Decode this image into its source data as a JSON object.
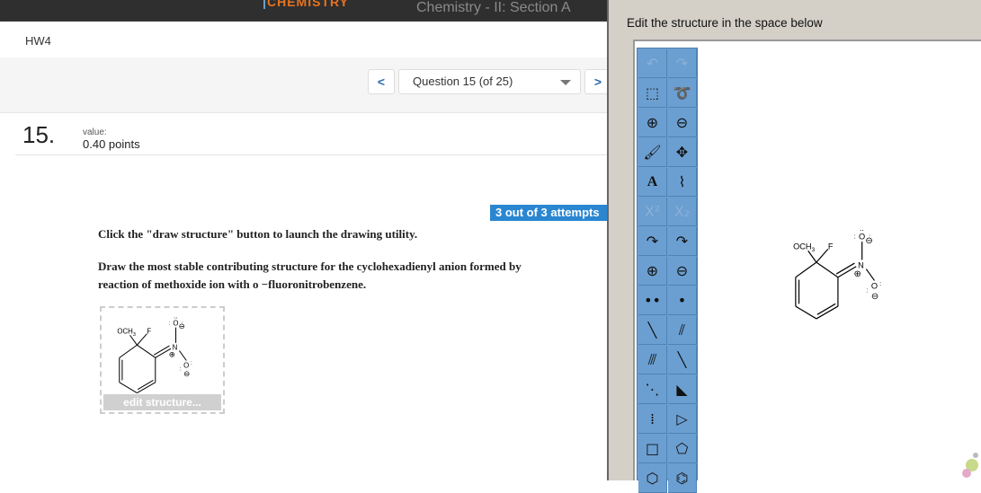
{
  "header": {
    "brand": "CHEMISTRY",
    "course": "Chemistry - II: Section A",
    "assignment": "HW4"
  },
  "nav": {
    "prev": "<",
    "next": ">",
    "question_select": "Question 15 (of 25)"
  },
  "question": {
    "number": "15.",
    "value_label": "value:",
    "points": "0.40 points",
    "attempts": "3 out of 3 attempts",
    "instruction1": "Click the \"draw structure\" button to launch the drawing utility.",
    "instruction2": "Draw the most stable contributing structure for the cyclohexadienyl anion formed by",
    "instruction3": "reaction of methoxide ion with o −fluoronitrobenzene.",
    "edit_button": "edit structure..."
  },
  "molecule": {
    "och3": "OCH",
    "sub3": "3",
    "f": "F",
    "n": "N",
    "o": "O",
    "plus": "⊕",
    "minus": "⊖"
  },
  "editor": {
    "title": "Edit the structure in the space below",
    "tools": [
      {
        "icon": "undo-icon",
        "g": "↶",
        "d": true
      },
      {
        "icon": "redo-icon",
        "g": "↷",
        "d": true
      },
      {
        "icon": "rect-select-icon",
        "g": "⬚"
      },
      {
        "icon": "lasso-icon",
        "g": "➰"
      },
      {
        "icon": "zoom-in-icon",
        "g": "⊕"
      },
      {
        "icon": "zoom-out-icon",
        "g": "⊖"
      },
      {
        "icon": "eraser-icon",
        "g": "🖌"
      },
      {
        "icon": "move-icon",
        "g": "✥"
      },
      {
        "icon": "text-icon",
        "g": "A"
      },
      {
        "icon": "chain-icon",
        "g": "⌇"
      },
      {
        "icon": "superscript-icon",
        "g": "X²",
        "d": true
      },
      {
        "icon": "subscript-icon",
        "g": "X₂",
        "d": true
      },
      {
        "icon": "curved-arrow-pair-icon",
        "g": "↷"
      },
      {
        "icon": "curved-arrow-single-icon",
        "g": "↷"
      },
      {
        "icon": "plus-charge-icon",
        "g": "⊕"
      },
      {
        "icon": "minus-charge-icon",
        "g": "⊖"
      },
      {
        "icon": "lone-pair-icon",
        "g": "••"
      },
      {
        "icon": "radical-icon",
        "g": "•"
      },
      {
        "icon": "single-bond-icon",
        "g": "╲"
      },
      {
        "icon": "double-bond-icon",
        "g": "⫽"
      },
      {
        "icon": "triple-bond-icon",
        "g": "⫻"
      },
      {
        "icon": "bold-bond-icon",
        "g": "╲"
      },
      {
        "icon": "dashed-bond-icon",
        "g": "⋱"
      },
      {
        "icon": "wedge-bond-icon",
        "g": "◣"
      },
      {
        "icon": "hashed-wedge-icon",
        "g": "⁞"
      },
      {
        "icon": "triangle-icon",
        "g": "▷"
      },
      {
        "icon": "square-icon",
        "g": "□"
      },
      {
        "icon": "pentagon-icon",
        "g": "⬠"
      },
      {
        "icon": "hexagon-icon",
        "g": "⬡"
      },
      {
        "icon": "benzene-icon",
        "g": "⌬"
      }
    ]
  }
}
